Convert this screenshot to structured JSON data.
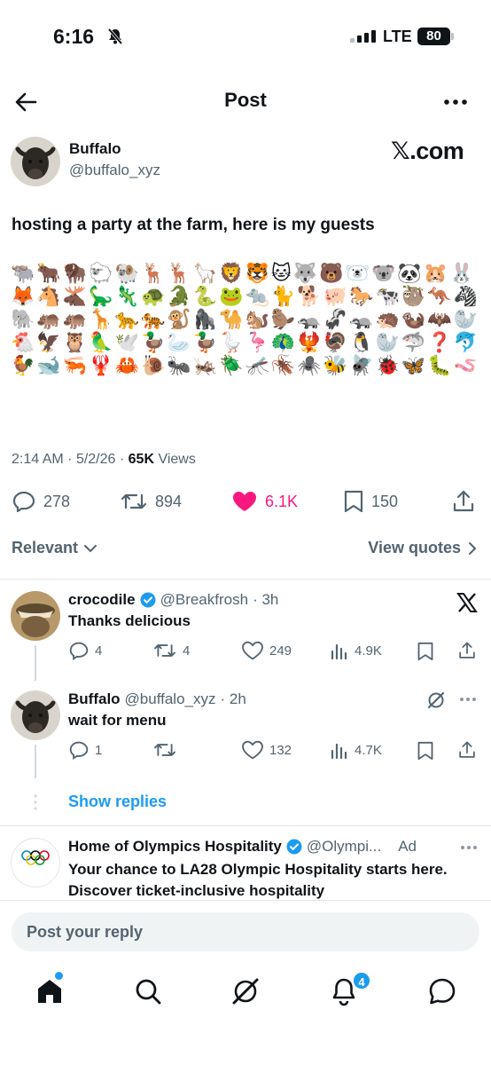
{
  "status_bar": {
    "time": "6:16",
    "network": "LTE",
    "battery": "80"
  },
  "header": {
    "title": "Post"
  },
  "post": {
    "author_name": "Buffalo",
    "author_handle": "@buffalo_xyz",
    "brand": "𝕏.com",
    "text": "hosting a party at the farm, here is my guests",
    "emoji": "🐃🐂🦬🐑🐏🦌🦌🦙🦁🐯🐱🐺🐻🐻‍❄️🐨🐼🐹🐰🦊🐴🫎🦕🦎🐢🐊🐍🐸🐀🐈🐕🐖🐎🐄🦥🦘🦓🐘🦛🦛🦒🐆🐅🐒🦍🐪🐿️🦫🦡🦨🦡🦔🦦🦇🦭🐔🦅🦉🦜🕊️🦆🦢🦆🪿🦩🦚🐦‍🔥🦃🐧🦭🦈❓🐬🐓🐋🦐🦞🦀🐌🐜🦗🪲🦟🪳🕷️🐝🪰🐞🦋🐛🪱",
    "time": "2:14 AM",
    "date": "5/2/26",
    "views": "65K",
    "views_label": "Views",
    "replies": "278",
    "reposts": "894",
    "likes": "6.1K",
    "bookmarks": "150"
  },
  "filters": {
    "sort": "Relevant",
    "quotes": "View quotes"
  },
  "replies": [
    {
      "name": "crocodile",
      "handle": "@Breakfrosh",
      "time": "· 3h",
      "text": "Thanks delicious",
      "replies": "4",
      "reposts": "4",
      "likes": "249",
      "views": "4.9K"
    },
    {
      "name": "Buffalo",
      "handle": "@buffalo_xyz",
      "time": "· 2h",
      "text": "wait for menu",
      "replies": "1",
      "likes": "132",
      "views": "4.7K"
    }
  ],
  "show_replies": "Show replies",
  "ad": {
    "name": "Home of Olympics Hospitality",
    "handle": "@Olympi...",
    "ad_label": "Ad",
    "logo_text": "Olympic\nHospitality",
    "text": "Your chance to LA28 Olympic Hospitality starts here. Discover ticket-inclusive hospitality"
  },
  "reply_bar": {
    "placeholder": "Post your reply"
  },
  "tab_bar": {
    "notifications_badge": "4"
  },
  "colors": {
    "accent": "#1d9bf0",
    "like": "#f91880",
    "secondary_text": "#536471"
  }
}
